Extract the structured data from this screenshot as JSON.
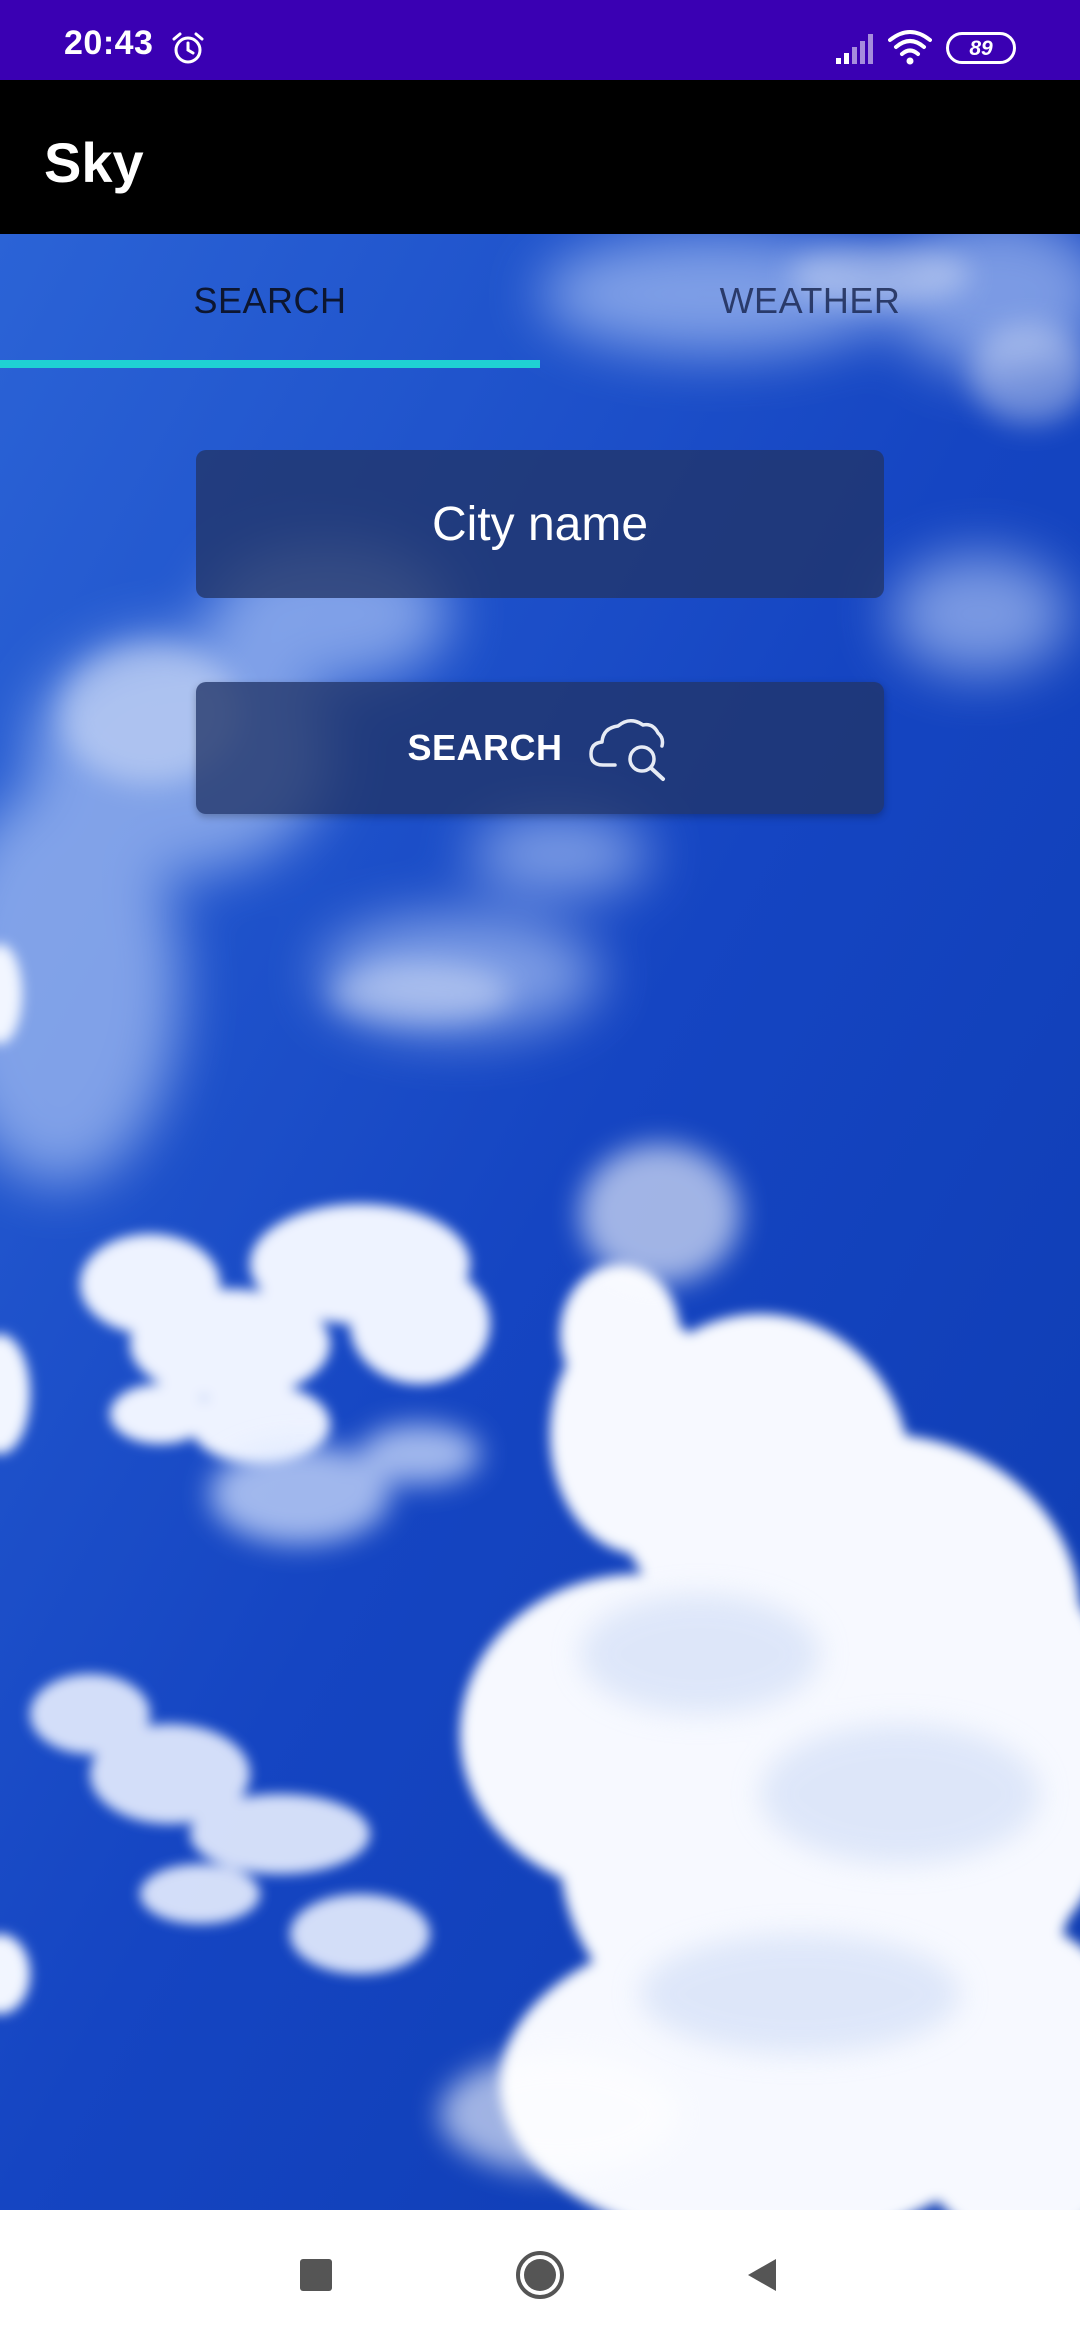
{
  "status_bar": {
    "time": "20:43",
    "battery_level": "89",
    "icons": [
      "alarm-icon",
      "signal-icon",
      "wifi-icon",
      "battery-icon"
    ]
  },
  "app_bar": {
    "title": "Sky"
  },
  "tabs": [
    {
      "label": "SEARCH",
      "selected": true
    },
    {
      "label": "WEATHER",
      "selected": false
    }
  ],
  "search_form": {
    "city_placeholder": "City name",
    "city_value": "",
    "search_label": "SEARCH",
    "search_icon": "cloud-search-icon"
  },
  "nav_bar": {
    "buttons": [
      "recents-button",
      "home-button",
      "back-button"
    ]
  },
  "colors": {
    "status_bar": "#3a00b3",
    "app_bar": "#000000",
    "tab_indicator": "#1fd1d3",
    "sky": "#1d4fd0",
    "nav_bar": "#ffffff"
  }
}
